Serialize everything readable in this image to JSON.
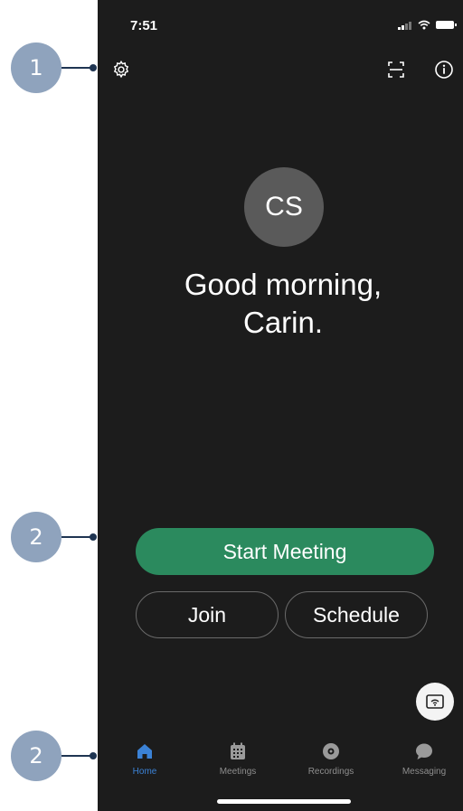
{
  "callouts": [
    "1",
    "2",
    "2"
  ],
  "status_bar": {
    "time": "7:51"
  },
  "header_icons": {
    "settings": "gear-icon",
    "scan": "scan-icon",
    "info": "info-icon"
  },
  "profile": {
    "initials": "CS",
    "greeting_line1": "Good morning,",
    "greeting_line2": "Carin."
  },
  "actions": {
    "start_meeting": "Start Meeting",
    "join": "Join",
    "schedule": "Schedule"
  },
  "share_screen_icon": "share-screen-icon",
  "tabs": [
    {
      "label": "Home",
      "icon": "home-icon",
      "active": true
    },
    {
      "label": "Meetings",
      "icon": "calendar-icon",
      "active": false
    },
    {
      "label": "Recordings",
      "icon": "recordings-icon",
      "active": false
    },
    {
      "label": "Messaging",
      "icon": "chat-bubble-icon",
      "active": false
    }
  ],
  "colors": {
    "background": "#1c1c1c",
    "accent_green": "#2b8a5e",
    "active_tab": "#3b82d6",
    "callout": "#8fa3bd"
  }
}
